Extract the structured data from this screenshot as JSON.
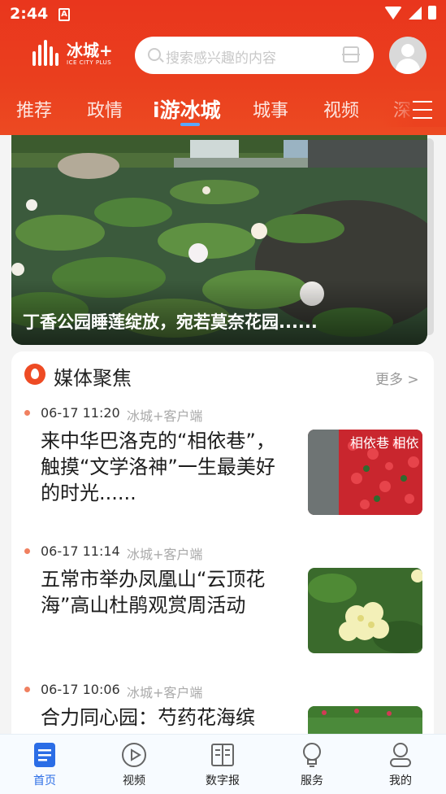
{
  "status": {
    "time": "2:44",
    "indicator": "A"
  },
  "header": {
    "logo": {
      "name": "冰城",
      "plus": "+",
      "sub": "ICE CITY PLUS"
    },
    "search_placeholder": "搜索感兴趣的内容",
    "tabs": [
      "推荐",
      "政情",
      "i游冰城",
      "城事",
      "视频",
      "深"
    ],
    "active_tab": "i游冰城"
  },
  "banner": {
    "caption": "丁香公园睡莲绽放，宛若莫奈花园......"
  },
  "media": {
    "title": "媒体聚焦",
    "more": "更多 >",
    "items": [
      {
        "time": "06-17 11:20",
        "source": "冰城+客户端",
        "title": "来中华巴洛克的“相依巷”，触摸“文学洛神”一生最美好的时光......",
        "thumb_text": "相依巷 相依"
      },
      {
        "time": "06-17 11:14",
        "source": "冰城+客户端",
        "title": "五常市举办凤凰山“云顶花海”高山杜鹃观赏周活动",
        "thumb_text": ""
      },
      {
        "time": "06-17 10:06",
        "source": "冰城+客户端",
        "title": "合力同心园：芍药花海缤",
        "thumb_text": ""
      }
    ]
  },
  "nav": {
    "items": [
      "首页",
      "视频",
      "数字报",
      "服务",
      "我的"
    ],
    "active": "首页"
  },
  "colors": {
    "brand": "#e9361d",
    "active_nav": "#2b6de6"
  }
}
